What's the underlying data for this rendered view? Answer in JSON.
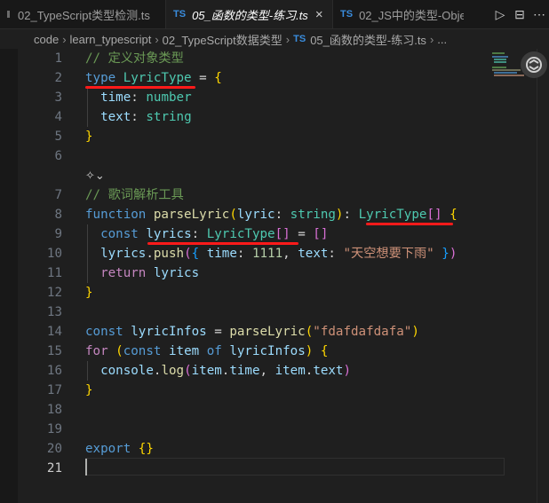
{
  "tabs": [
    {
      "label": "02_TypeScript类型检测.ts",
      "icon": "",
      "active": false
    },
    {
      "label": "05_函数的类型-练习.ts",
      "icon": "TS",
      "active": true
    },
    {
      "label": "02_JS中的类型-Obje",
      "icon": "TS",
      "active": false
    }
  ],
  "tab_close": "×",
  "tab_actions": {
    "run": "▷",
    "split": "⊟",
    "more": "⋯"
  },
  "breadcrumb": {
    "items": [
      "code",
      "learn_typescript",
      "02_TypeScript数据类型"
    ],
    "file_icon": "TS",
    "file": "05_函数的类型-练习.ts",
    "trailing": "...",
    "separator": "›"
  },
  "fold_hint": "✧⌄",
  "lines": [
    {
      "n": "1",
      "tokens": [
        [
          "cm",
          "// 定义对象类型"
        ]
      ]
    },
    {
      "n": "2",
      "tokens": [
        [
          "kw",
          "type"
        ],
        [
          "pu",
          " "
        ],
        [
          "ty",
          "LyricType"
        ],
        [
          "pu",
          " = "
        ],
        [
          "br1",
          "{"
        ]
      ]
    },
    {
      "n": "3",
      "tokens": [
        [
          "pu",
          "  "
        ],
        [
          "pr",
          "time"
        ],
        [
          "pu",
          ": "
        ],
        [
          "ty",
          "number"
        ]
      ]
    },
    {
      "n": "4",
      "tokens": [
        [
          "pu",
          "  "
        ],
        [
          "pr",
          "text"
        ],
        [
          "pu",
          ": "
        ],
        [
          "ty",
          "string"
        ]
      ]
    },
    {
      "n": "5",
      "tokens": [
        [
          "br1",
          "}"
        ]
      ]
    },
    {
      "n": "6",
      "tokens": []
    },
    {
      "n": "7",
      "tokens": [
        [
          "cm",
          "// 歌词解析工具"
        ]
      ]
    },
    {
      "n": "8",
      "tokens": [
        [
          "kw",
          "function"
        ],
        [
          "pu",
          " "
        ],
        [
          "fn",
          "parseLyric"
        ],
        [
          "br1",
          "("
        ],
        [
          "va",
          "lyric"
        ],
        [
          "pu",
          ": "
        ],
        [
          "ty",
          "string"
        ],
        [
          "br1",
          ")"
        ],
        [
          "pu",
          ": "
        ],
        [
          "ty",
          "LyricType"
        ],
        [
          "br2",
          "[]"
        ],
        [
          "pu",
          " "
        ],
        [
          "br1",
          "{"
        ]
      ]
    },
    {
      "n": "9",
      "tokens": [
        [
          "pu",
          "  "
        ],
        [
          "kw",
          "const"
        ],
        [
          "pu",
          " "
        ],
        [
          "va",
          "lyrics"
        ],
        [
          "pu",
          ": "
        ],
        [
          "ty",
          "LyricType"
        ],
        [
          "br2",
          "[]"
        ],
        [
          "pu",
          " = "
        ],
        [
          "br2",
          "[]"
        ]
      ]
    },
    {
      "n": "10",
      "tokens": [
        [
          "pu",
          "  "
        ],
        [
          "va",
          "lyrics"
        ],
        [
          "pu",
          "."
        ],
        [
          "fn",
          "push"
        ],
        [
          "br2",
          "("
        ],
        [
          "br3",
          "{"
        ],
        [
          "pu",
          " "
        ],
        [
          "pr",
          "time"
        ],
        [
          "pu",
          ": "
        ],
        [
          "nu",
          "1111"
        ],
        [
          "pu",
          ", "
        ],
        [
          "pr",
          "text"
        ],
        [
          "pu",
          ": "
        ],
        [
          "st",
          "\"天空想要下雨\""
        ],
        [
          "pu",
          " "
        ],
        [
          "br3",
          "}"
        ],
        [
          "br2",
          ")"
        ]
      ]
    },
    {
      "n": "11",
      "tokens": [
        [
          "pu",
          "  "
        ],
        [
          "ctl",
          "return"
        ],
        [
          "pu",
          " "
        ],
        [
          "va",
          "lyrics"
        ]
      ]
    },
    {
      "n": "12",
      "tokens": [
        [
          "br1",
          "}"
        ]
      ]
    },
    {
      "n": "13",
      "tokens": []
    },
    {
      "n": "14",
      "tokens": [
        [
          "kw",
          "const"
        ],
        [
          "pu",
          " "
        ],
        [
          "va",
          "lyricInfos"
        ],
        [
          "pu",
          " = "
        ],
        [
          "fn",
          "parseLyric"
        ],
        [
          "br1",
          "("
        ],
        [
          "st",
          "\"fdafdafdafa\""
        ],
        [
          "br1",
          ")"
        ]
      ]
    },
    {
      "n": "15",
      "tokens": [
        [
          "ctl",
          "for"
        ],
        [
          "pu",
          " "
        ],
        [
          "br1",
          "("
        ],
        [
          "kw",
          "const"
        ],
        [
          "pu",
          " "
        ],
        [
          "va",
          "item"
        ],
        [
          "pu",
          " "
        ],
        [
          "kw",
          "of"
        ],
        [
          "pu",
          " "
        ],
        [
          "va",
          "lyricInfos"
        ],
        [
          "br1",
          ")"
        ],
        [
          "pu",
          " "
        ],
        [
          "br1",
          "{"
        ]
      ]
    },
    {
      "n": "16",
      "tokens": [
        [
          "pu",
          "  "
        ],
        [
          "va",
          "console"
        ],
        [
          "pu",
          "."
        ],
        [
          "fn",
          "log"
        ],
        [
          "br2",
          "("
        ],
        [
          "va",
          "item"
        ],
        [
          "pu",
          "."
        ],
        [
          "pr",
          "time"
        ],
        [
          "pu",
          ", "
        ],
        [
          "va",
          "item"
        ],
        [
          "pu",
          "."
        ],
        [
          "pr",
          "text"
        ],
        [
          "br2",
          ")"
        ]
      ]
    },
    {
      "n": "17",
      "tokens": [
        [
          "br1",
          "}"
        ]
      ]
    },
    {
      "n": "18",
      "tokens": []
    },
    {
      "n": "19",
      "tokens": []
    },
    {
      "n": "20",
      "tokens": [
        [
          "kw",
          "export"
        ],
        [
          "pu",
          " "
        ],
        [
          "br1",
          "{}"
        ]
      ]
    },
    {
      "n": "21",
      "tokens": []
    }
  ],
  "colors": {
    "underline": "#ff1a1a",
    "keyword": "#569cd6",
    "type": "#4ec9b0",
    "comment": "#6a9955"
  },
  "icons": {
    "copilot": "copilot-icon",
    "ts": "typescript-icon"
  }
}
